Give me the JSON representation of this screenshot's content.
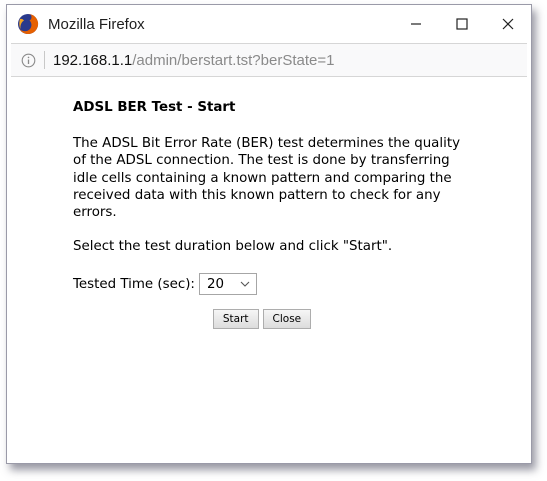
{
  "window": {
    "title": "Mozilla Firefox",
    "controls": {
      "minimize_icon": "minimize-icon",
      "maximize_icon": "maximize-icon",
      "close_icon": "close-icon"
    }
  },
  "urlbar": {
    "host": "192.168.1.1",
    "path": "/admin/berstart.tst?berState=1",
    "icon": "info-icon"
  },
  "page": {
    "heading": "ADSL BER Test - Start",
    "description": "The ADSL Bit Error Rate (BER) test determines the quality of the ADSL connection. The test is done by transferring idle cells containing a known pattern and comparing the received data with this known pattern to check for any errors.",
    "instruction": "Select the test duration below and click \"Start\".",
    "tested_time_label": "Tested Time (sec):",
    "tested_time_value": "20",
    "start_label": "Start",
    "close_label": "Close"
  },
  "colors": {
    "firefox_orange": "#e66000",
    "firefox_blue": "#2a3a8c",
    "window_border": "#9a9aa8"
  }
}
